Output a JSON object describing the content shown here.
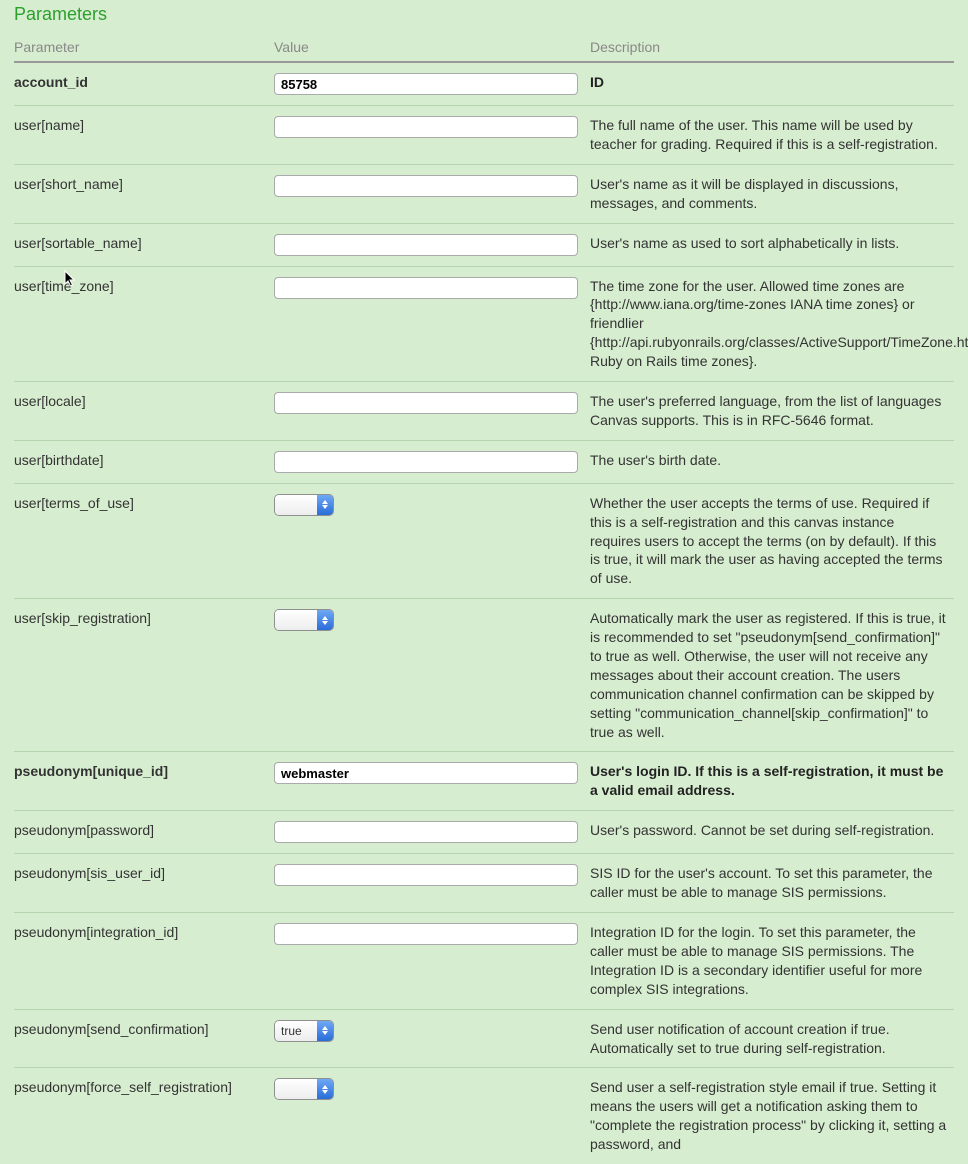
{
  "title": "Parameters",
  "headers": {
    "parameter": "Parameter",
    "value": "Value",
    "description": "Description"
  },
  "rows": [
    {
      "name": "account_id",
      "type": "text",
      "value": "85758",
      "desc": "ID",
      "bold": true
    },
    {
      "name": "user[name]",
      "type": "text",
      "value": "",
      "desc": "The full name of the user. This name will be used by teacher for grading. Required if this is a self-registration."
    },
    {
      "name": "user[short_name]",
      "type": "text",
      "value": "",
      "desc": "User's name as it will be displayed in discussions, messages, and comments."
    },
    {
      "name": "user[sortable_name]",
      "type": "text",
      "value": "",
      "desc": "User's name as used to sort alphabetically in lists."
    },
    {
      "name": "user[time_zone]",
      "type": "text",
      "value": "",
      "desc": "The time zone for the user. Allowed time zones are {http://www.iana.org/time-zones IANA time zones} or friendlier {http://api.rubyonrails.org/classes/ActiveSupport/TimeZone.html Ruby on Rails time zones}."
    },
    {
      "name": "user[locale]",
      "type": "text",
      "value": "",
      "desc": "The user's preferred language, from the list of languages Canvas supports. This is in RFC-5646 format."
    },
    {
      "name": "user[birthdate]",
      "type": "text",
      "value": "",
      "desc": "The user's birth date."
    },
    {
      "name": "user[terms_of_use]",
      "type": "select",
      "value": "",
      "desc": "Whether the user accepts the terms of use. Required if this is a self-registration and this canvas instance requires users to accept the terms (on by default). If this is true, it will mark the user as having accepted the terms of use."
    },
    {
      "name": "user[skip_registration]",
      "type": "select",
      "value": "",
      "desc": "Automatically mark the user as registered. If this is true, it is recommended to set \"pseudonym[send_confirmation]\" to true as well. Otherwise, the user will not receive any messages about their account creation. The users communication channel confirmation can be skipped by setting \"communication_channel[skip_confirmation]\" to true as well."
    },
    {
      "name": "pseudonym[unique_id]",
      "type": "text",
      "value": "webmaster",
      "desc": "User's login ID. If this is a self-registration, it must be a valid email address.",
      "bold": true
    },
    {
      "name": "pseudonym[password]",
      "type": "text",
      "value": "",
      "desc": "User's password. Cannot be set during self-registration."
    },
    {
      "name": "pseudonym[sis_user_id]",
      "type": "text",
      "value": "",
      "desc": "SIS ID for the user's account. To set this parameter, the caller must be able to manage SIS permissions."
    },
    {
      "name": "pseudonym[integration_id]",
      "type": "text",
      "value": "",
      "desc": "Integration ID for the login. To set this parameter, the caller must be able to manage SIS permissions. The Integration ID is a secondary identifier useful for more complex SIS integrations."
    },
    {
      "name": "pseudonym[send_confirmation]",
      "type": "select",
      "value": "true",
      "desc": "Send user notification of account creation if true. Automatically set to true during self-registration."
    },
    {
      "name": "pseudonym[force_self_registration]",
      "type": "select",
      "value": "",
      "desc": "Send user a self-registration style email if true. Setting it means the users will get a notification asking them to \"complete the registration process\" by clicking it, setting a password, and"
    }
  ]
}
